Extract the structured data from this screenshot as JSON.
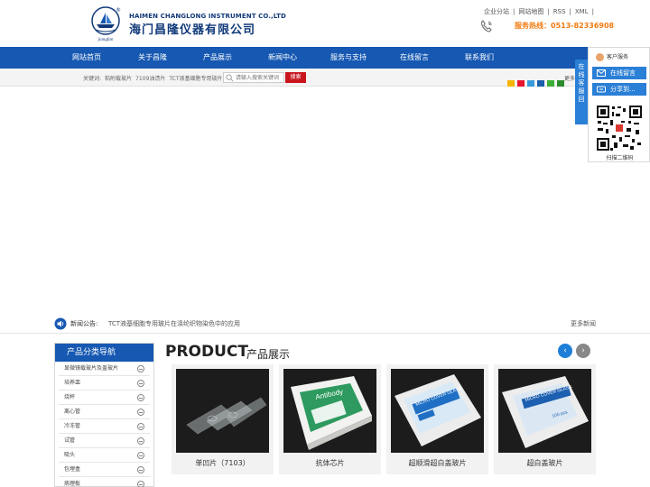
{
  "header": {
    "brand_en": "HAIMEN CHANGLONG INSTRUMENT CO.,LTD",
    "brand_cn": "海门昌隆仪器有限公司",
    "logo_text": "jiangfan",
    "registered": "®",
    "top_links": [
      "企业分站",
      "|",
      "网站地图",
      "|",
      "RSS",
      "|",
      "XML",
      "|"
    ],
    "hotline_label": "服务热线：",
    "hotline_number": "0513-82336908"
  },
  "nav": {
    "items": [
      "网站首页",
      "关于昌隆",
      "产品展示",
      "新闻中心",
      "服务与支持",
      "在线留言",
      "联系我们"
    ]
  },
  "search": {
    "keywords_label": "关键词:",
    "keywords": [
      "粘附载玻片",
      "7109油渍片",
      "TCT液基细胞专用玻片"
    ],
    "placeholder": "请输入搜索关键词",
    "button_label": "搜索",
    "more_share": "更多"
  },
  "news": {
    "label": "新闻公告:",
    "headline": "TCT液基细胞专用玻片在涤纶织物染色中的应用",
    "more": "更多新闻"
  },
  "categories": {
    "title": "产品分类导航",
    "items": [
      "显微镜载玻片及盖玻片",
      "培养皿",
      "烧杯",
      "离心管",
      "冷冻管",
      "试管",
      "吸头",
      "包埋盒",
      "病理板"
    ]
  },
  "products": {
    "title_en": "PRODUCT",
    "title_cn": "产品展示",
    "prev": "‹",
    "next": "›",
    "items": [
      {
        "caption": "单凹片（7103）"
      },
      {
        "caption": "抗体芯片"
      },
      {
        "caption": "超顺滑超白盖玻片"
      },
      {
        "caption": "超白盖玻片"
      }
    ],
    "box_labels": {
      "antibody": "Antibody",
      "micro_cover": "MICRO COVER GLASS",
      "micro_cover2": "MICRO COVER GLASS",
      "count": "100 pcs"
    }
  },
  "float_service": {
    "tab_label": [
      "在",
      "线",
      "客",
      "服",
      "回"
    ],
    "service_label": "客户服务",
    "message_label": "在线留言",
    "share_label": "分享到...",
    "qr_caption": "扫描二维码"
  }
}
